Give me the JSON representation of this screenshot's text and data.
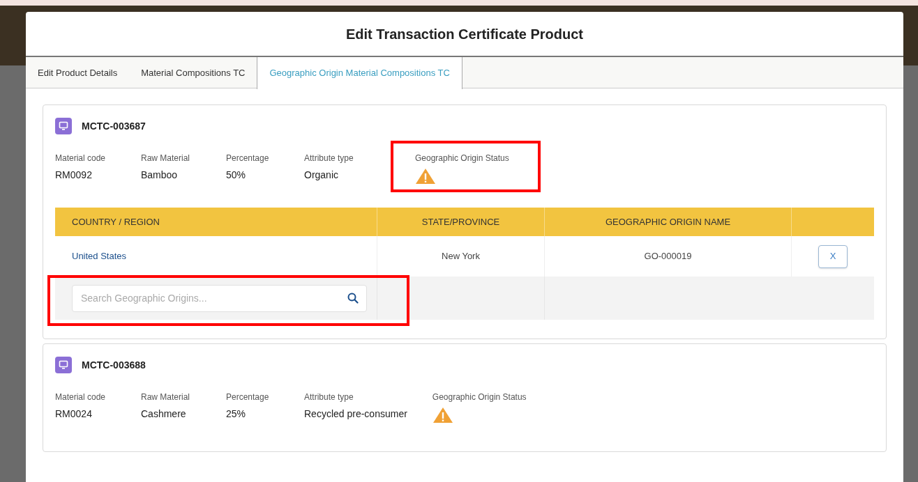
{
  "modal": {
    "title": "Edit Transaction Certificate Product"
  },
  "tabs": [
    {
      "label": "Edit Product Details",
      "selected": false
    },
    {
      "label": "Material Compositions TC",
      "selected": false
    },
    {
      "label": "Geographic Origin Material Compositions TC",
      "selected": true
    }
  ],
  "cards": [
    {
      "id": "MCTC-003687",
      "highlight_status": true,
      "fields": [
        {
          "label": "Material code",
          "value": "RM0092"
        },
        {
          "label": "Raw Material",
          "value": "Bamboo"
        },
        {
          "label": "Percentage",
          "value": "50%"
        },
        {
          "label": "Attribute type",
          "value": "Organic"
        }
      ],
      "status": {
        "label": "Geographic Origin Status",
        "kind": "warning"
      },
      "table": {
        "columns": [
          "COUNTRY / REGION",
          "STATE/PROVINCE",
          "GEOGRAPHIC ORIGIN NAME"
        ],
        "rows": [
          {
            "country": "United States",
            "state": "New York",
            "name": "GO-000019",
            "remove": "X"
          }
        ],
        "search": {
          "placeholder": "Search Geographic Origins...",
          "highlighted": true
        }
      }
    },
    {
      "id": "MCTC-003688",
      "highlight_status": false,
      "fields": [
        {
          "label": "Material code",
          "value": "RM0024"
        },
        {
          "label": "Raw Material",
          "value": "Cashmere"
        },
        {
          "label": "Percentage",
          "value": "25%"
        },
        {
          "label": "Attribute type",
          "value": "Recycled pre-consumer"
        }
      ],
      "status": {
        "label": "Geographic Origin Status",
        "kind": "warning"
      }
    }
  ]
}
